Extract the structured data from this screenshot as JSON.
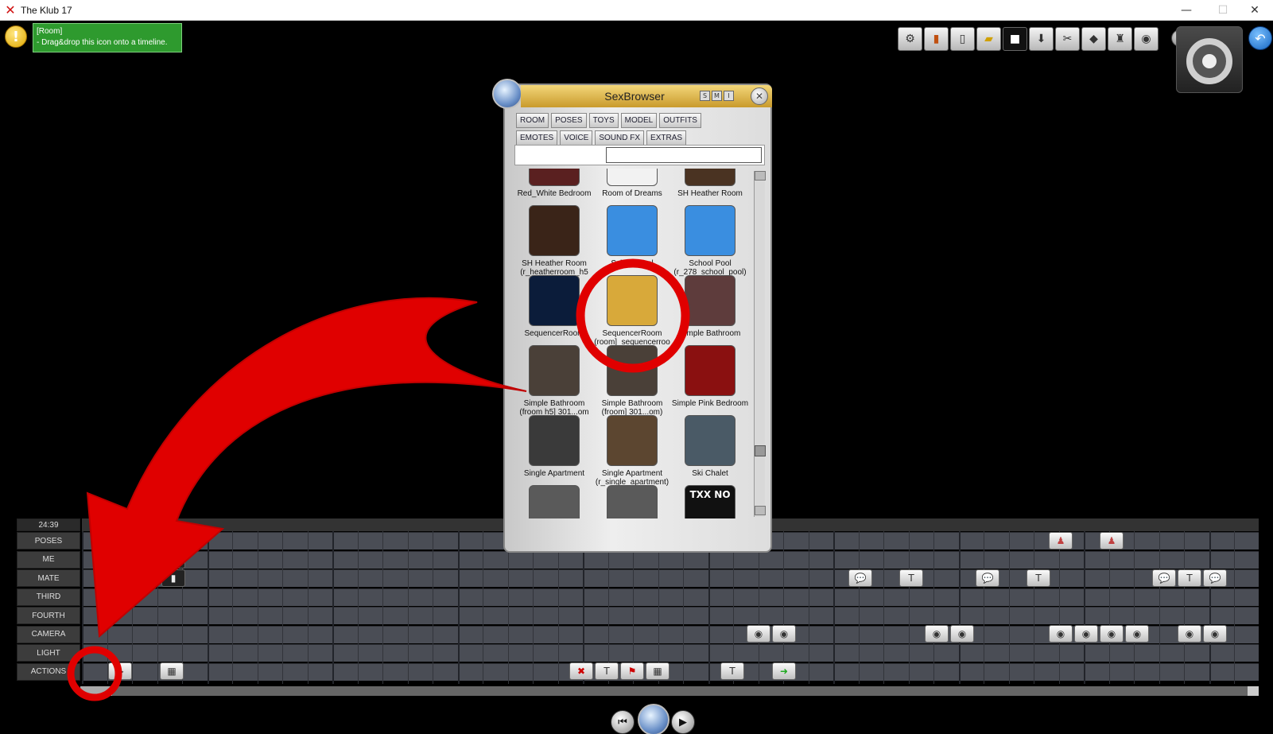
{
  "window": {
    "title": "The Klub 17",
    "min": "—",
    "max": "☐",
    "close": "✕"
  },
  "hint": {
    "line1": "[Room]",
    "line2": "- Drag&drop this icon onto a timeline."
  },
  "browser": {
    "title": "SexBrowser",
    "header_buttons": [
      "S",
      "M",
      "I"
    ],
    "tabs_row1": [
      "ROOM",
      "POSES",
      "TOYS",
      "MODEL",
      "OUTFITS"
    ],
    "tabs_row2": [
      "EMOTES",
      "VOICE",
      "SOUND FX",
      "EXTRAS"
    ],
    "search_value": "",
    "items": [
      {
        "caption": "Red_White Bedroom",
        "color": "#5a2020"
      },
      {
        "caption": "Room of Dreams",
        "color": "#f2f2f2"
      },
      {
        "caption": "SH Heather Room",
        "color": "#4a3322"
      },
      {
        "caption": "SH Heather Room (r_heatherroom_h5",
        "color": "#3a2418"
      },
      {
        "caption": "School Pool",
        "color": "#3a8ee0"
      },
      {
        "caption": "School Pool (r_278_school_pool)",
        "color": "#3a8ee0"
      },
      {
        "caption": "SequencerRoom",
        "color": "#0b1c3a"
      },
      {
        "caption": "SequencerRoom (room]_sequencerroo",
        "color": "#d8a93a"
      },
      {
        "caption": "Simple Bathroom",
        "color": "#5e3c3c"
      },
      {
        "caption": "Simple Bathroom (froom h5] 301...om",
        "color": "#4a4038"
      },
      {
        "caption": "Simple Bathroom (froom] 301...om)",
        "color": "#4a4038"
      },
      {
        "caption": "Simple Pink Bedroom",
        "color": "#8a1010"
      },
      {
        "caption": "Single Apartment",
        "color": "#3a3a3a"
      },
      {
        "caption": "Single Apartment (r_single_apartment)",
        "color": "#5c4630"
      },
      {
        "caption": "Ski Chalet",
        "color": "#4a5a66"
      },
      {
        "caption": "",
        "color": "#5a5a5a"
      },
      {
        "caption": "",
        "color": "#5a5a5a"
      },
      {
        "caption": "TXX NO",
        "color": "#111111"
      }
    ]
  },
  "timeline": {
    "time": "24:39",
    "rows": [
      "POSES",
      "ME",
      "MATE",
      "THIRD",
      "FOURTH",
      "CAMERA",
      "LIGHT",
      "ACTIONS"
    ]
  },
  "toolbar": {
    "icons": [
      "camera-people-icon",
      "books-icon",
      "new-page-icon",
      "folder-open-icon",
      "video-icon",
      "download-icon",
      "scissors-icon",
      "car-icon",
      "robot-icon",
      "camera-icon"
    ]
  },
  "playback": {
    "rewind": "⏮",
    "play": "▶"
  },
  "colors": {
    "accent_red": "#e00000",
    "hint_green": "#2e9a2e",
    "browser_header": "#e0b84e"
  }
}
